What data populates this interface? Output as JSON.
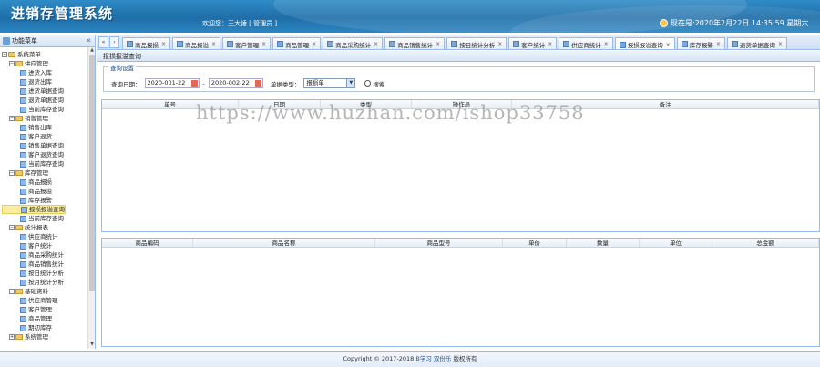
{
  "header": {
    "title": "进销存管理系统",
    "welcome": "欢迎您：王大锤 [ 管理员 ]",
    "clock": "现在是:2020年2月22日 14:35:59 星期六"
  },
  "sidebar": {
    "title": "功能菜单",
    "collapse_glyph": "«",
    "root": "系统菜单",
    "groups": [
      {
        "label": "供应管理",
        "items": [
          "进货入库",
          "退货出库",
          "进货单据查询",
          "退货单据查询",
          "当前库存查询"
        ]
      },
      {
        "label": "销售管理",
        "items": [
          "销售出库",
          "客户退货",
          "销售单据查询",
          "客户退货查询",
          "当前库存查询"
        ]
      },
      {
        "label": "库存管理",
        "items": [
          "商品报损",
          "商品报溢",
          "库存报警",
          "报损报溢查询",
          "当前库存查询"
        ]
      },
      {
        "label": "统计报表",
        "items": [
          "供应商统计",
          "客户统计",
          "商品采购统计",
          "商品销售统计",
          "按日统计分析",
          "按月统计分析"
        ]
      },
      {
        "label": "基础资料",
        "items": [
          "供应商管理",
          "客户管理",
          "商品管理",
          "期初库存"
        ]
      },
      {
        "label": "系统管理",
        "items": []
      }
    ],
    "selected": "报损报溢查询"
  },
  "tabs": {
    "nav_left": "«",
    "nav_right": "›",
    "items": [
      {
        "label": "商品报损"
      },
      {
        "label": "商品报溢"
      },
      {
        "label": "客户管理"
      },
      {
        "label": "商品管理"
      },
      {
        "label": "商品采购统计"
      },
      {
        "label": "商品销售统计"
      },
      {
        "label": "按日统计分析"
      },
      {
        "label": "客户统计"
      },
      {
        "label": "供应商统计"
      },
      {
        "label": "报损报溢查询"
      },
      {
        "label": "库存报警"
      },
      {
        "label": "退货单据查询"
      }
    ],
    "active": "报损报溢查询",
    "close_glyph": "×"
  },
  "main": {
    "page_title": "报损报溢查询",
    "query_legend": "查询设置",
    "date_label": "查询日期：",
    "start_date": "2020-001-22",
    "date_sep": "-",
    "end_date": "2020-002-22",
    "type_label": "单据类型：",
    "type_value": "报损单",
    "search_label": "搜索",
    "grid1_columns": [
      "单号",
      "日期",
      "类型",
      "操作员",
      "备注"
    ],
    "grid2_columns": [
      "商品编码",
      "商品名称",
      "商品型号",
      "单价",
      "数量",
      "单位",
      "总金额"
    ]
  },
  "watermark": "https://www.huzhan.com/ishop33758",
  "footer": {
    "copyright": "Copyright © 2017-2018 ",
    "link": "B学习 双份乐",
    "rights": " 版权所有"
  }
}
